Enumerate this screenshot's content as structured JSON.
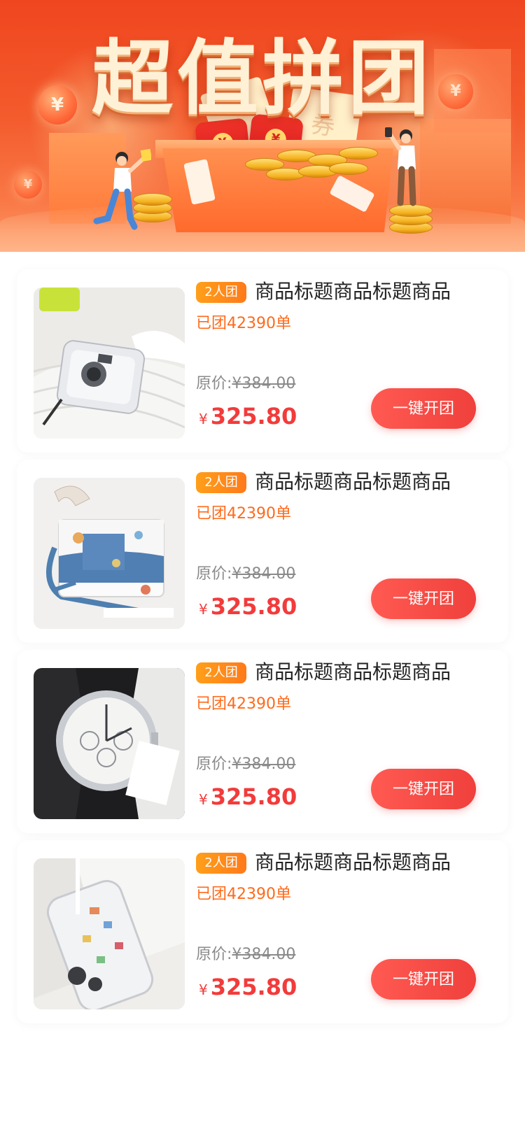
{
  "banner": {
    "title": "超值拼团",
    "yen_glyph": "¥",
    "ticket_glyph": "券"
  },
  "products": [
    {
      "image": "camera-photo",
      "tag": "2人团",
      "title": "商品标题商品标题商品",
      "sold": "已团42390单",
      "original_label": "原价:",
      "original_price": "¥384.00",
      "price_symbol": "¥",
      "price": "325.80",
      "button": "一键开团"
    },
    {
      "image": "handbag-photo",
      "tag": "2人团",
      "title": "商品标题商品标题商品",
      "sold": "已团42390单",
      "original_label": "原价:",
      "original_price": "¥384.00",
      "price_symbol": "¥",
      "price": "325.80",
      "button": "一键开团"
    },
    {
      "image": "watch-photo",
      "tag": "2人团",
      "title": "商品标题商品标题商品",
      "sold": "已团42390单",
      "original_label": "原价:",
      "original_price": "¥384.00",
      "price_symbol": "¥",
      "price": "325.80",
      "button": "一键开团"
    },
    {
      "image": "phone-case-photo",
      "tag": "2人团",
      "title": "商品标题商品标题商品",
      "sold": "已团42390单",
      "original_label": "原价:",
      "original_price": "¥384.00",
      "price_symbol": "¥",
      "price": "325.80",
      "button": "一键开团"
    }
  ],
  "colors": {
    "banner_red": "#f0461f",
    "tag_orange": "#ff8a1a",
    "sold_orange": "#ff6a1a",
    "price_red": "#f23b3b",
    "button_red": "#f0403c"
  }
}
